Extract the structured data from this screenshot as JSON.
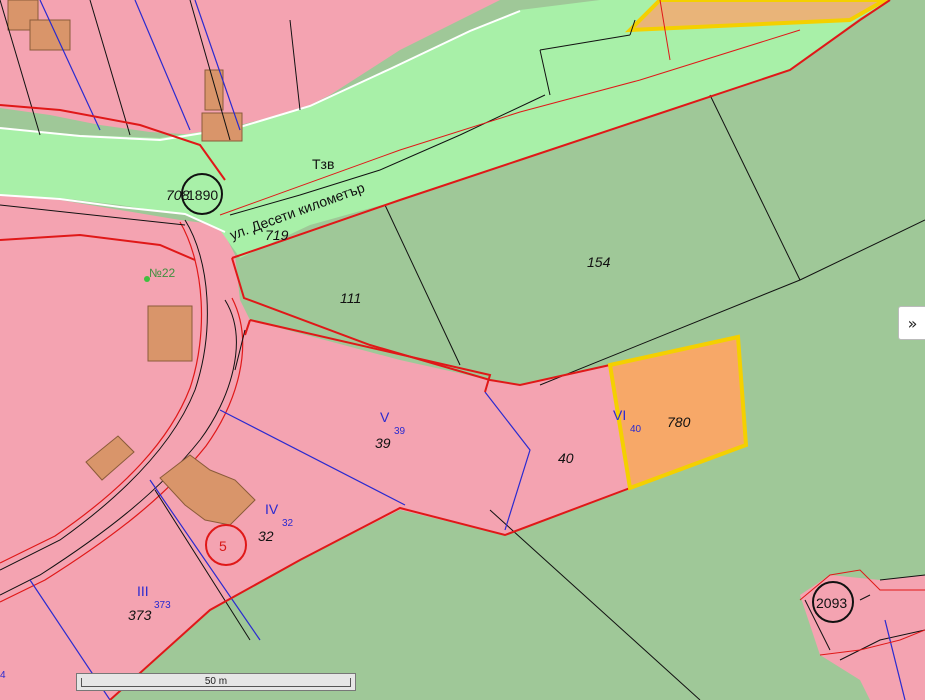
{
  "map": {
    "street_name": "ул. Десети километър",
    "street_code": "Тзв",
    "zone_prefix": "708",
    "marker_1890": "1890",
    "plot_719": "719",
    "plot_154": "154",
    "plot_111": "111",
    "address_no22": "№22",
    "plot_V_roman": "V",
    "plot_V_sub": "39",
    "plot_39": "39",
    "plot_40": "40",
    "plot_VI_roman": "VI",
    "plot_VI_sub": "40",
    "plot_780": "780",
    "plot_IV_roman": "IV",
    "plot_IV_sub": "32",
    "plot_32": "32",
    "marker_5": "5",
    "plot_III_roman": "III",
    "plot_III_sub": "373",
    "plot_373": "373",
    "marker_2093": "2093",
    "edge_4": "4"
  },
  "scale": {
    "label": "50 m"
  },
  "controls": {
    "expand_label": "»"
  },
  "colors": {
    "urban_plot": "#f4a3b1",
    "street": "#a8f0a8",
    "agricultural": "#9fc898",
    "building": "#d9956a",
    "highlight_outline": "#f4d000",
    "highlight_fill": "#f7a868",
    "boundary_red": "#e01818",
    "boundary_blue": "#2a2ad0"
  }
}
